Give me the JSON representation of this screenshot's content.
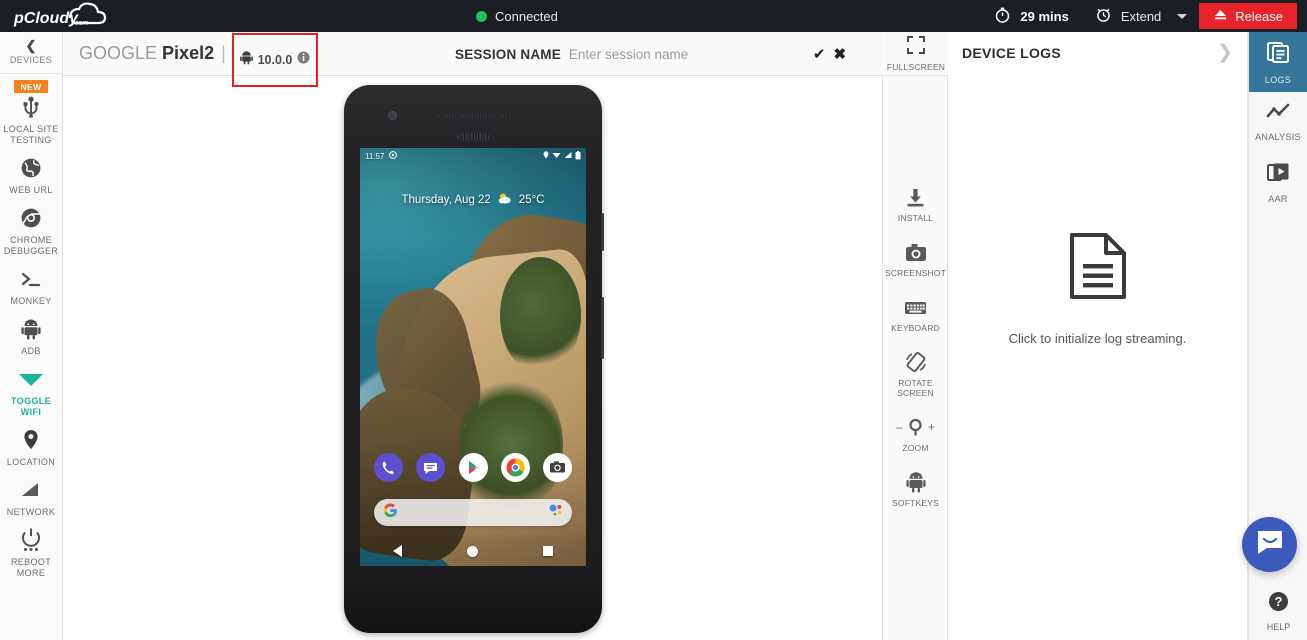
{
  "topbar": {
    "logo_text": "pCloudy",
    "logo_suffix": ".com",
    "connection_status": "Connected",
    "connection_color": "#20c15c",
    "timer_label": "29 mins",
    "extend_label": "Extend",
    "release_label": "Release",
    "release_color": "#e8232a"
  },
  "sidebar": {
    "collapse_label": "DEVICES",
    "collapse_icon": "chevron-left-icon",
    "items": [
      {
        "label": "LOCAL SITE TESTING",
        "icon": "usb-icon",
        "badge": "NEW",
        "active": false
      },
      {
        "label": "WEB URL",
        "icon": "globe-icon",
        "badge": "",
        "active": false
      },
      {
        "label": "CHROME DEBUGGER",
        "icon": "chrome-icon",
        "badge": "",
        "active": false
      },
      {
        "label": "MONKEY",
        "icon": "terminal-icon",
        "badge": "",
        "active": false
      },
      {
        "label": "ADB",
        "icon": "android-icon",
        "badge": "",
        "active": false
      },
      {
        "label": "TOGGLE WIFI",
        "icon": "wifi-icon",
        "badge": "",
        "active": true
      },
      {
        "label": "LOCATION",
        "icon": "map-pin-icon",
        "badge": "",
        "active": false
      },
      {
        "label": "NETWORK",
        "icon": "signal-icon",
        "badge": "",
        "active": false
      },
      {
        "label": "REBOOT MORE",
        "icon": "power-icon",
        "badge": "",
        "active": false
      }
    ],
    "active_color": "#1db398",
    "badge_color": "#f58220"
  },
  "device_header": {
    "brand": "GOOGLE",
    "model": "Pixel2",
    "separator": "|",
    "os_version": "10.0.0",
    "os_icon": "android-icon",
    "info_icon": "info-icon",
    "highlight_color": "#e82020",
    "session_label": "SESSION NAME",
    "session_value": "",
    "session_placeholder": "Enter session name",
    "confirm_icon": "check-icon",
    "cancel_icon": "close-icon",
    "fullscreen_label": "FULLSCREEN",
    "fullscreen_icon": "fullscreen-icon"
  },
  "device_screen": {
    "status_time": "11:57",
    "status_icons": [
      "location-icon",
      "wifi-icon",
      "signal-icon",
      "battery-icon"
    ],
    "widget_date": "Thursday, Aug 22",
    "widget_temp": "25°C",
    "widget_weather_icon": "partly-cloudy-icon",
    "dock_apps": [
      "phone-icon",
      "messages-icon",
      "play-store-icon",
      "chrome-icon",
      "camera-icon"
    ],
    "search_left_icon": "google-g-icon",
    "search_right_icon": "google-assistant-icon",
    "nav_buttons": [
      "back-icon",
      "home-icon",
      "recents-icon"
    ]
  },
  "tools": [
    {
      "label": "INSTALL",
      "icon": "download-icon"
    },
    {
      "label": "SCREENSHOT",
      "icon": "camera-icon"
    },
    {
      "label": "KEYBOARD",
      "icon": "keyboard-icon"
    },
    {
      "label": "ROTATE SCREEN",
      "icon": "rotate-icon"
    },
    {
      "label": "ZOOM",
      "icon": "magnifier-icon",
      "minus": "–",
      "plus": "+"
    },
    {
      "label": "SOFTKEYS",
      "icon": "android-robot-icon"
    }
  ],
  "logs_panel": {
    "title": "DEVICE LOGS",
    "collapse_icon": "chevron-right-icon",
    "empty_icon": "document-icon",
    "empty_text": "Click to initialize log streaming."
  },
  "right_rail": {
    "items": [
      {
        "label": "LOGS",
        "icon": "logs-icon",
        "active": true
      },
      {
        "label": "ANALYSIS",
        "icon": "line-chart-icon",
        "active": false
      },
      {
        "label": "AAR",
        "icon": "video-icon",
        "active": false
      }
    ],
    "active_color": "#33769a",
    "help_label": "HELP",
    "help_icon": "question-mark-icon",
    "chat_icon": "intercom-chat-icon",
    "chat_color": "#3a5bbc"
  }
}
